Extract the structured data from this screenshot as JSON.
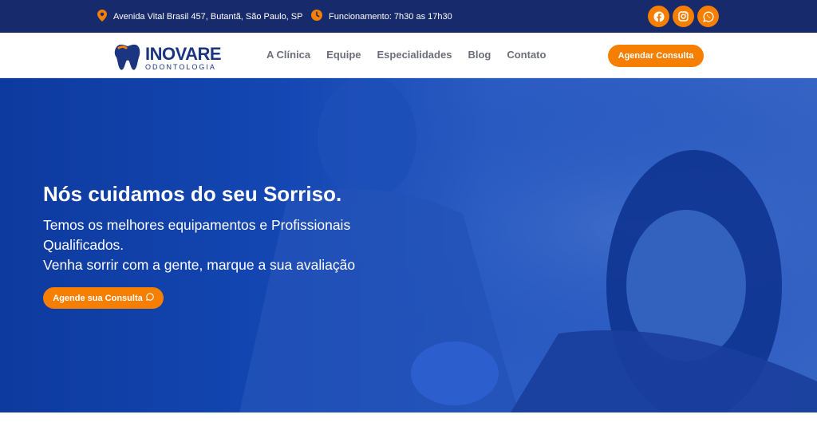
{
  "topbar": {
    "address": "Avenida Vital Brasil 457, Butantã, São Paulo, SP",
    "hours": "Funcionamento: 7h30 as 17h30",
    "socials": [
      "facebook-icon",
      "instagram-icon",
      "whatsapp-icon"
    ]
  },
  "header": {
    "logo": {
      "name": "INOVARE",
      "sub": "ODONTOLOGIA"
    },
    "nav": [
      "A Clínica",
      "Equipe",
      "Especialidades",
      "Blog",
      "Contato"
    ],
    "cta": "Agendar Consulta"
  },
  "hero": {
    "title": "Nós cuidamos do seu Sorriso.",
    "lines": [
      "Temos os melhores equipamentos e Profissionais",
      "Qualificados.",
      "Venha sorrir com a gente, marque a sua avaliação"
    ],
    "cta": "Agende sua Consulta"
  },
  "colors": {
    "primary": "#172a6b",
    "accent": "#f77f00",
    "hero_blue": "#1447b3"
  }
}
